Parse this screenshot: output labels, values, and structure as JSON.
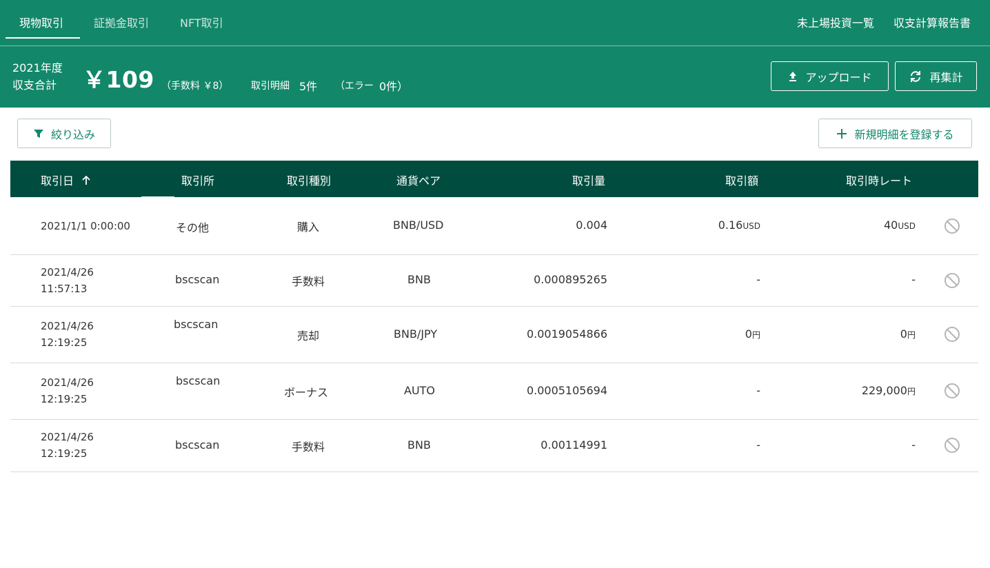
{
  "tabs": {
    "spot": "現物取引",
    "margin": "証拠金取引",
    "nft": "NFT取引"
  },
  "top_links": {
    "unlisted": "未上場投資一覧",
    "report": "収支計算報告書"
  },
  "summary": {
    "fiscal_year": "2021年度",
    "label": "収支合計",
    "total": "￥109",
    "fee": "（手数料 ￥8）",
    "detail_label": "取引明細",
    "detail_count": "5件",
    "error_label": "（エラー",
    "error_count": "0件）",
    "upload_label": "アップロード",
    "recalc_label": "再集計"
  },
  "toolbar": {
    "filter_label": "絞り込み",
    "add_label": "新規明細を登録する"
  },
  "table": {
    "headers": {
      "date": "取引日",
      "exchange": "取引所",
      "type": "取引種別",
      "pair": "通貨ペア",
      "amount": "取引量",
      "value": "取引額",
      "rate": "取引時レート"
    },
    "rows": [
      {
        "date1": "2021/1/1 0:00:00",
        "date2": "",
        "exchange": "その他",
        "type": "購入",
        "pair": "BNB/USD",
        "amount": "0.004",
        "value": "0.16",
        "value_unit": "USD",
        "rate": "40",
        "rate_unit": "USD"
      },
      {
        "date1": "2021/4/26",
        "date2": "11:57:13",
        "exchange": "bscscan",
        "type": "手数料",
        "pair": "BNB",
        "amount": "0.000895265",
        "value": "-",
        "value_unit": "",
        "rate": "-",
        "rate_unit": ""
      },
      {
        "date1": "2021/4/26",
        "date2": "12:19:25",
        "exchange": "bscscan",
        "type": "売却",
        "pair": "BNB/JPY",
        "amount": "0.0019054866",
        "value": "0",
        "value_unit": "円",
        "rate": "0",
        "rate_unit": "円"
      },
      {
        "date1": "2021/4/26",
        "date2": "12:19:25",
        "exchange": "bscscan",
        "type": "ボーナス",
        "pair": "AUTO",
        "amount": "0.0005105694",
        "value": "-",
        "value_unit": "",
        "rate": "229,000",
        "rate_unit": "円"
      },
      {
        "date1": "2021/4/26",
        "date2": "12:19:25",
        "exchange": "bscscan",
        "type": "手数料",
        "pair": "BNB",
        "amount": "0.00114991",
        "value": "-",
        "value_unit": "",
        "rate": "-",
        "rate_unit": ""
      }
    ]
  },
  "colors": {
    "brand": "#13876a",
    "header_dark": "#004d40"
  }
}
